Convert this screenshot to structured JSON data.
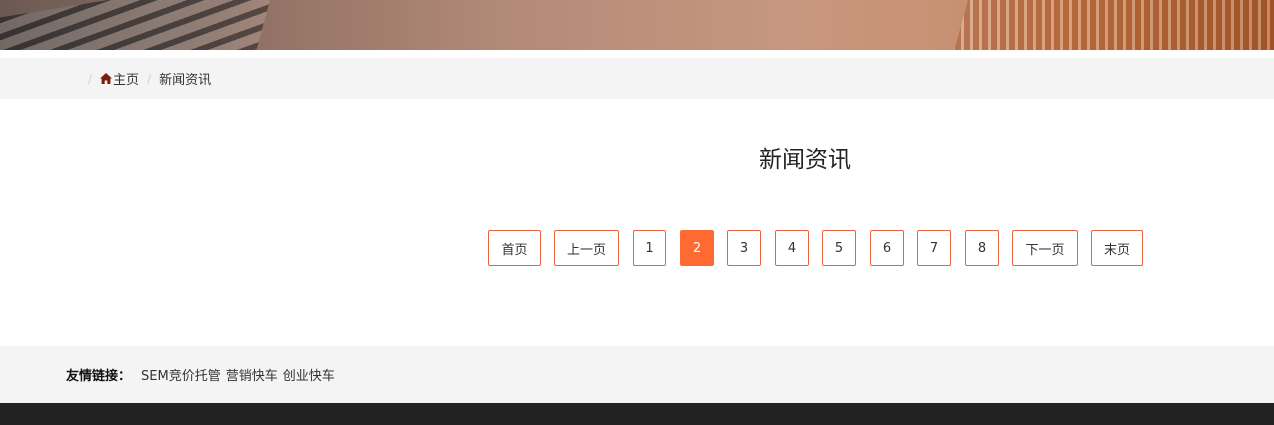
{
  "breadcrumb": {
    "home_label": "主页",
    "current_label": "新闻资讯"
  },
  "page": {
    "title": "新闻资讯"
  },
  "pagination": {
    "first": "首页",
    "prev": "上一页",
    "pages": [
      "1",
      "2",
      "3",
      "4",
      "5",
      "6",
      "7",
      "8"
    ],
    "current": "2",
    "next": "下一页",
    "last": "末页"
  },
  "friend_links": {
    "label": "友情链接：",
    "items": [
      "SEM竞价托管",
      "营销快车",
      "创业快车"
    ]
  },
  "colors": {
    "accent": "#ff6a33",
    "border": "#e8633a",
    "footer_dark": "#222222"
  }
}
